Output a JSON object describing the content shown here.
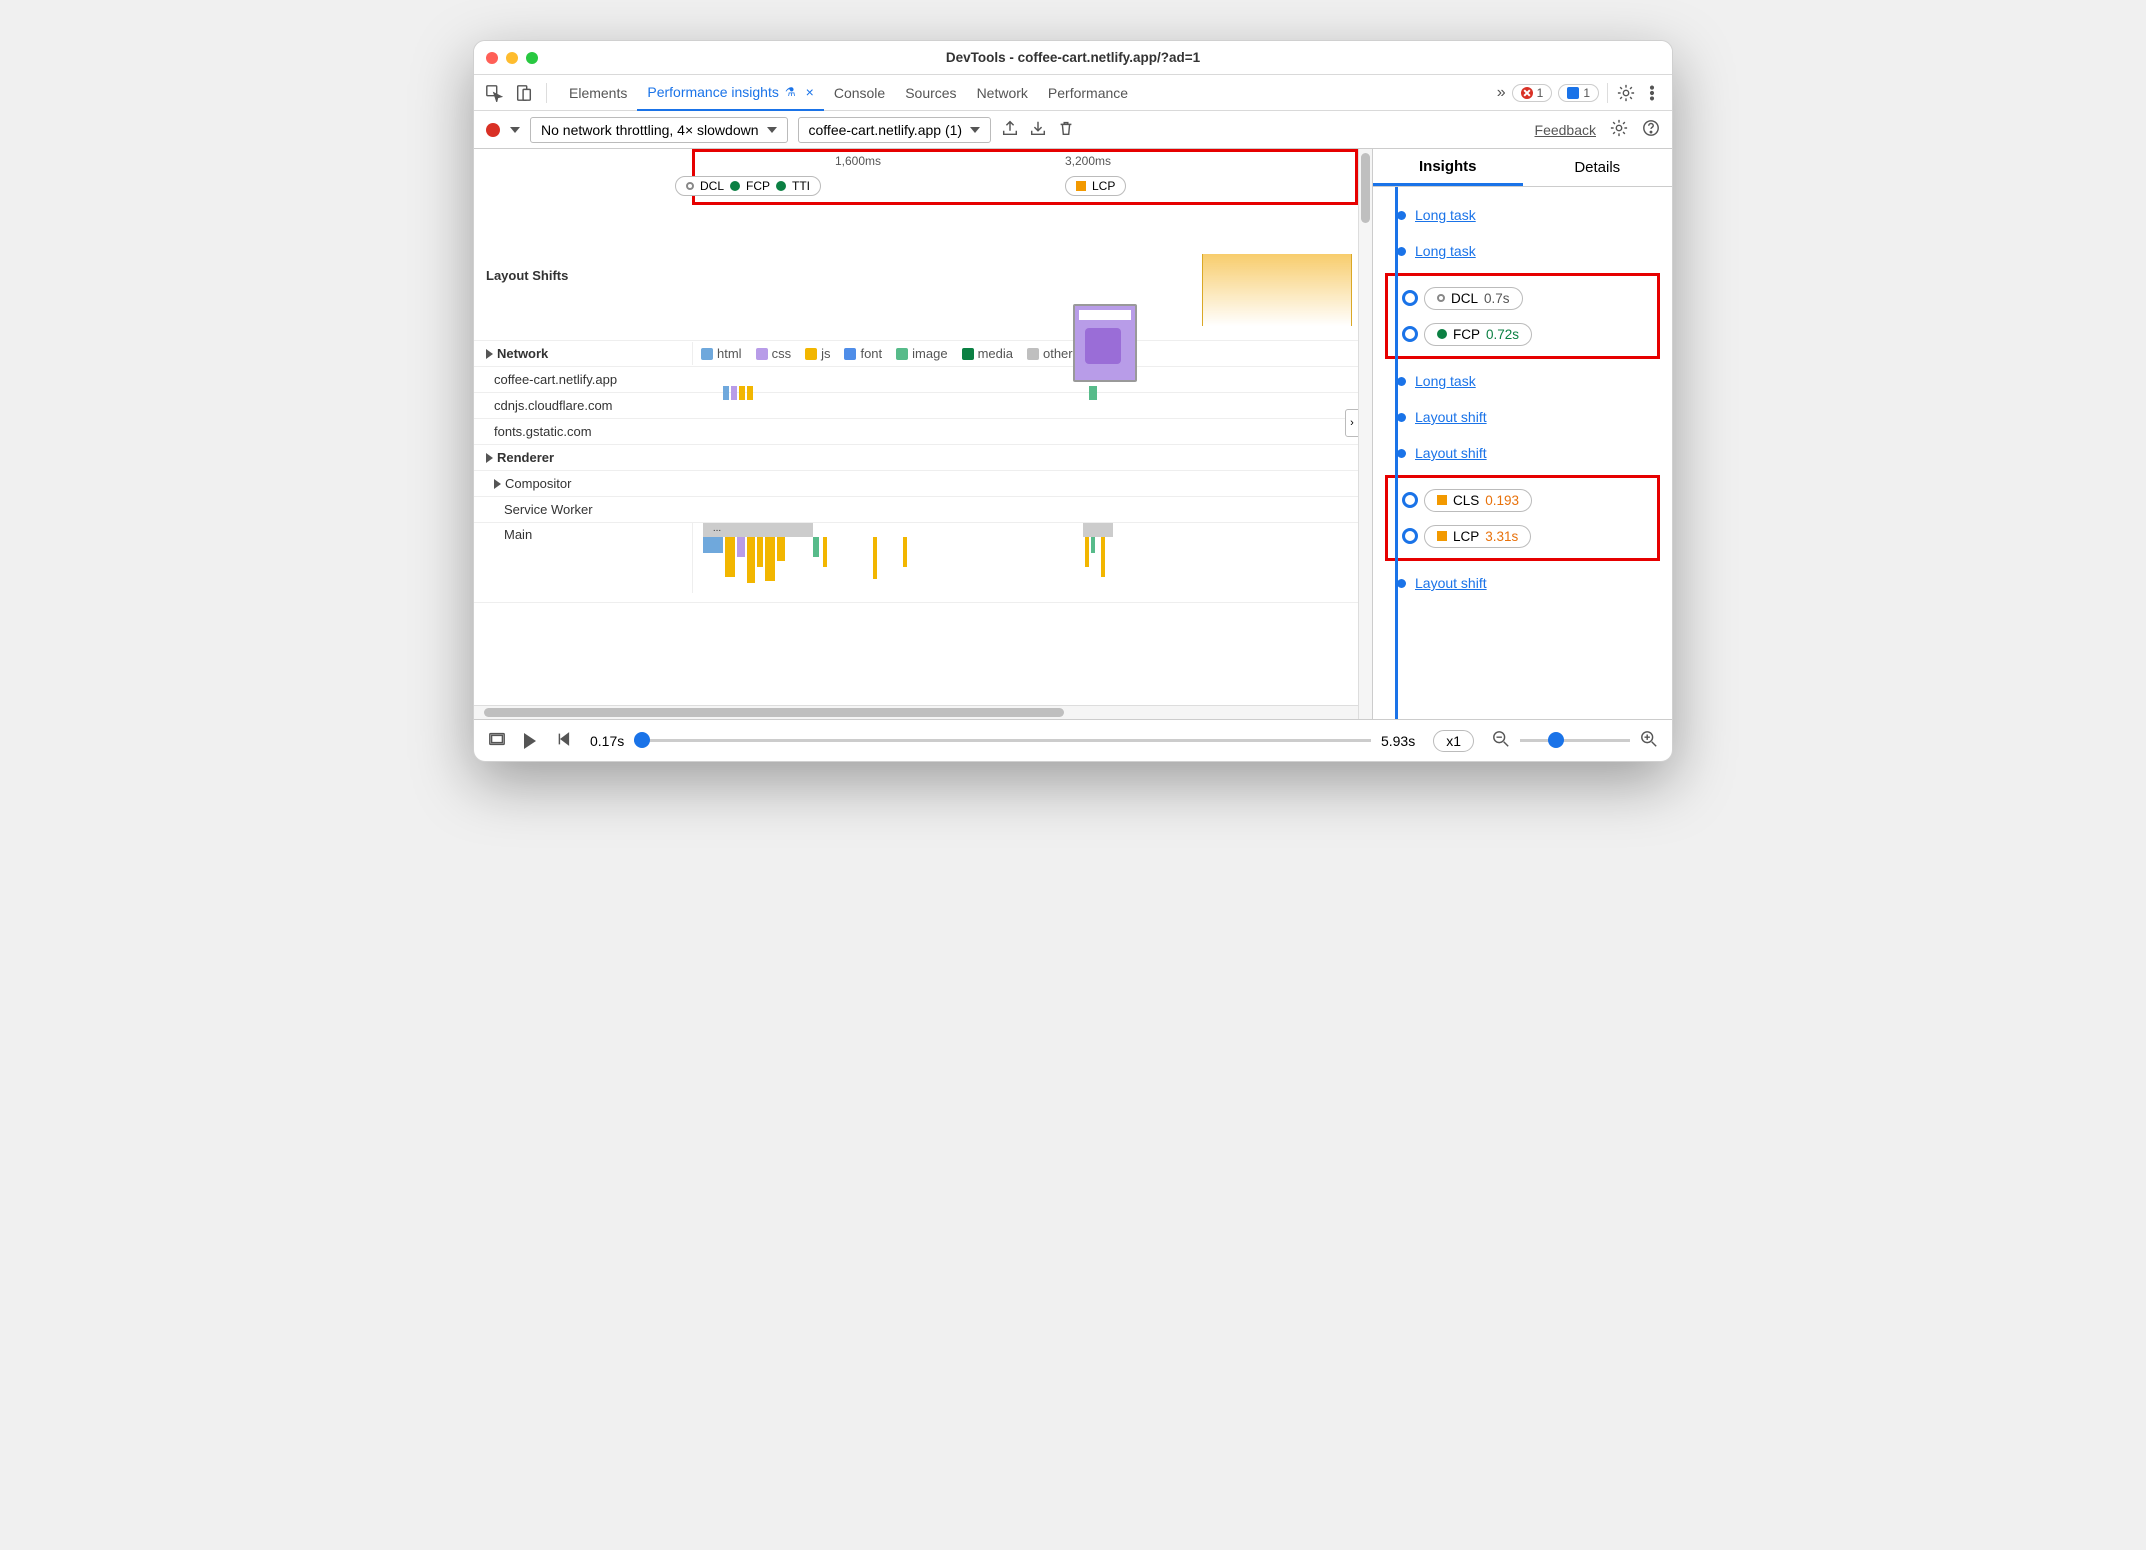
{
  "window": {
    "title": "DevTools - coffee-cart.netlify.app/?ad=1"
  },
  "tabs": {
    "items": [
      "Elements",
      "Performance insights",
      "Console",
      "Sources",
      "Network",
      "Performance"
    ],
    "active_index": 1,
    "overflow_glyph": "»",
    "error_count": "1",
    "message_count": "1"
  },
  "toolbar": {
    "throttling": "No network throttling, 4× slowdown",
    "trace": "coffee-cart.netlify.app (1)",
    "feedback": "Feedback"
  },
  "timeline_header": {
    "ticks": [
      "1,600ms",
      "3,200ms"
    ],
    "pill1_items": [
      {
        "name": "DCL",
        "dot": "hollow"
      },
      {
        "name": "FCP",
        "dot": "green"
      },
      {
        "name": "TTI",
        "dot": "green"
      }
    ],
    "pill2": {
      "name": "LCP",
      "shape": "orange-square"
    }
  },
  "rows": {
    "layout_shifts": "Layout Shifts",
    "network": "Network",
    "renderer": "Renderer",
    "compositor": "Compositor",
    "service_worker": "Service Worker",
    "main": "Main",
    "hosts": [
      "coffee-cart.netlify.app",
      "cdnjs.cloudflare.com",
      "fonts.gstatic.com"
    ]
  },
  "legend": [
    {
      "label": "html",
      "color": "#6fa8dc"
    },
    {
      "label": "css",
      "color": "#b89ce8"
    },
    {
      "label": "js",
      "color": "#f2b600"
    },
    {
      "label": "font",
      "color": "#4f8de8"
    },
    {
      "label": "image",
      "color": "#57bb8a"
    },
    {
      "label": "media",
      "color": "#0b8043"
    },
    {
      "label": "other",
      "color": "#bfbfbf"
    }
  ],
  "footer": {
    "time_start": "0.17s",
    "time_end": "5.93s",
    "speed": "x1"
  },
  "insights": {
    "tabs": [
      "Insights",
      "Details"
    ],
    "active": 0,
    "events": [
      {
        "type": "link",
        "label": "Long task"
      },
      {
        "type": "link",
        "label": "Long task"
      },
      {
        "type": "group",
        "boxed": true,
        "items": [
          {
            "type": "pill",
            "marker": "big",
            "icon": "hollow",
            "label": "DCL",
            "value": "0.7s",
            "valclass": "val-gray"
          },
          {
            "type": "pill",
            "marker": "big",
            "icon": "green-dot",
            "label": "FCP",
            "value": "0.72s",
            "valclass": "val-green"
          }
        ]
      },
      {
        "type": "link",
        "label": "Long task"
      },
      {
        "type": "link",
        "label": "Layout shift"
      },
      {
        "type": "link",
        "label": "Layout shift"
      },
      {
        "type": "group",
        "boxed": true,
        "items": [
          {
            "type": "pill",
            "marker": "big",
            "icon": "orange-square",
            "label": "CLS",
            "value": "0.193",
            "valclass": "val-orange"
          },
          {
            "type": "pill",
            "marker": "big",
            "icon": "orange-square",
            "label": "LCP",
            "value": "3.31s",
            "valclass": "val-orange"
          }
        ]
      },
      {
        "type": "link",
        "label": "Layout shift"
      }
    ]
  }
}
